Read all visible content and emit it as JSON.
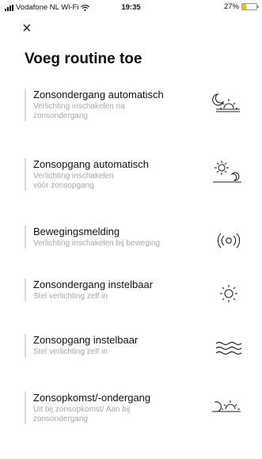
{
  "status_bar": {
    "carrier": "Vodafone NL Wi-Fi",
    "time": "19:35",
    "battery": "27%",
    "battery_level": 0.27
  },
  "header": {
    "close_label": "×",
    "title": "Voeg routine toe"
  },
  "routines": [
    {
      "title": "Zonsondergang automatisch",
      "subtitle": "Verlichting inschakelen na zonsondergang",
      "icon": "moon-sunset-icon"
    },
    {
      "title": "Zonsopgang automatisch",
      "subtitle": "Verlichting inschakelen vóór zonsopgang",
      "icon": "sunrise-icon"
    },
    {
      "title": "Bewegingsmelding",
      "subtitle": "Verlichting inschakelen bij beweging",
      "icon": "motion-sensor-icon"
    },
    {
      "title": "Zonsondergang instelbaar",
      "subtitle": "Stel verlichting zelf in",
      "icon": "sun-icon"
    },
    {
      "title": "Zonsopgang instelbaar",
      "subtitle": "Stel verlichting zelf in",
      "icon": "waves-icon"
    },
    {
      "title": "Zonsopkomst/-ondergang",
      "subtitle": "Uit bij zonsopkomst/ Aan bij zonsondergang",
      "icon": "moon-sun-icon"
    }
  ]
}
